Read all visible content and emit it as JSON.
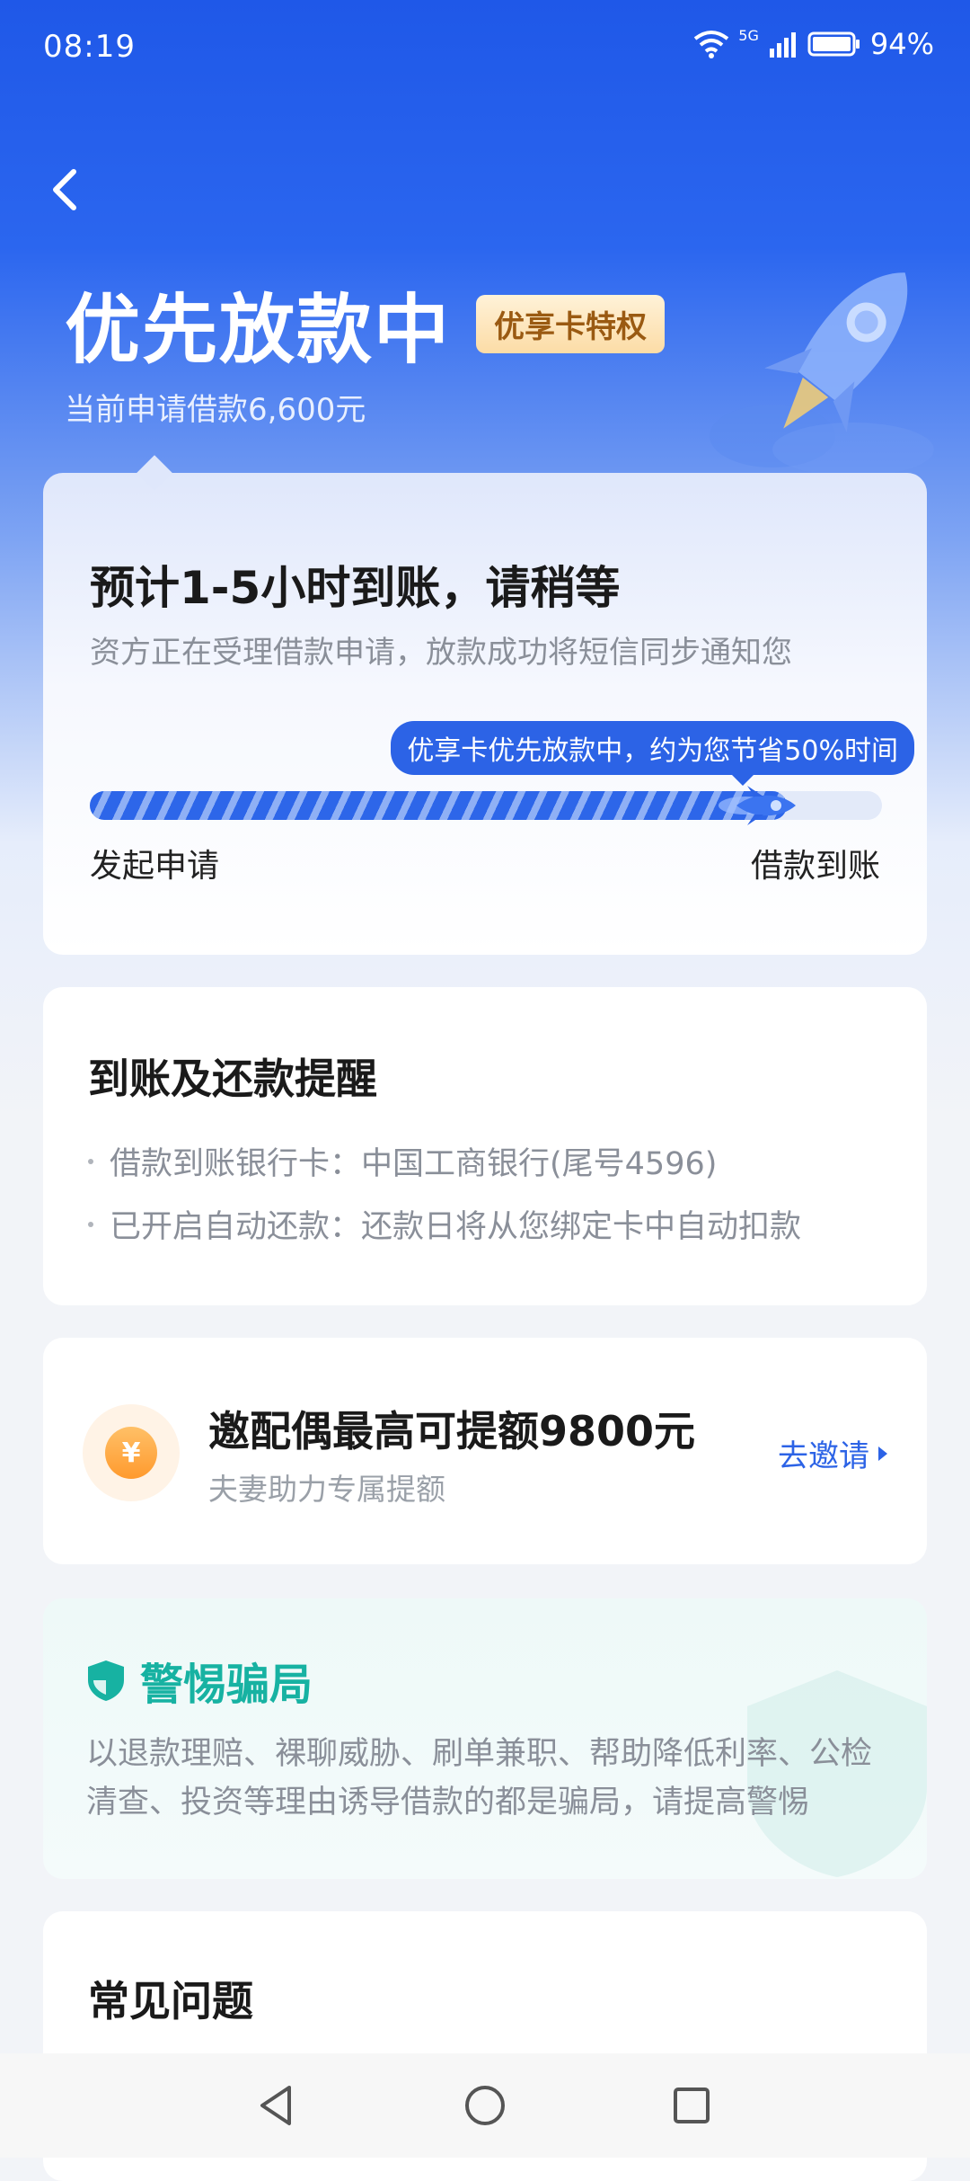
{
  "status_bar": {
    "time": "08:19",
    "network": "5G",
    "battery": "94%"
  },
  "header": {
    "title": "优先放款中",
    "badge": "优享卡特权",
    "subtitle": "当前申请借款6,600元"
  },
  "status_card": {
    "estimate": "预计1-5小时到账，请稍等",
    "description": "资方正在受理借款申请，放款成功将短信同步通知您",
    "tip": "优享卡优先放款中，约为您节省50%时间",
    "progress": 0.88,
    "start_label": "发起申请",
    "end_label": "借款到账"
  },
  "reminder": {
    "title": "到账及还款提醒",
    "items": [
      "借款到账银行卡：中国工商银行(尾号4596)",
      "已开启自动还款：还款日将从您绑定卡中自动扣款"
    ]
  },
  "invite": {
    "coin_symbol": "¥",
    "title": "邀配偶最高可提额9800元",
    "subtitle": "夫妻助力专属提额",
    "action": "去邀请"
  },
  "scam_warning": {
    "title": "警惕骗局",
    "text": "以退款理赔、裸聊威胁、刷单兼职、帮助降低利率、公检清查、投资等理由诱导借款的都是骗局，请提高警惕"
  },
  "faq": {
    "title": "常见问题"
  },
  "colors": {
    "primary": "#2c63e6",
    "warning_green": "#17b2a2",
    "badge_text": "#9a5a12"
  }
}
